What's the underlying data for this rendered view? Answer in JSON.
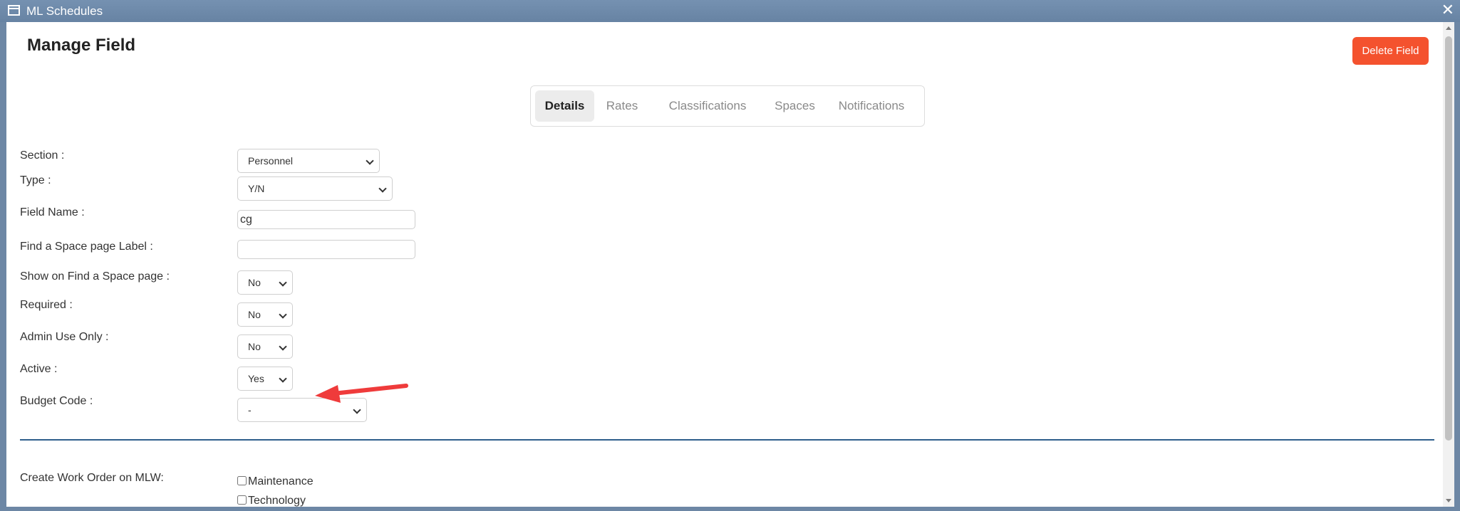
{
  "window": {
    "title": "ML Schedules",
    "icon": "window-icon",
    "close_symbol": "✕"
  },
  "header": {
    "title": "Manage Field",
    "delete_button": "Delete Field",
    "delete_color": "#f4522e"
  },
  "tabs": {
    "items": [
      "Details",
      "Rates",
      "Classifications",
      "Spaces",
      "Notifications"
    ],
    "active": "Details"
  },
  "form": {
    "section": {
      "label": "Section :",
      "value": "Personnel"
    },
    "type": {
      "label": "Type :",
      "value": "Y/N"
    },
    "field_name": {
      "label": "Field Name :",
      "value": "cg"
    },
    "space_label": {
      "label": "Find a Space page Label :",
      "value": ""
    },
    "show_on_find": {
      "label": "Show on Find a Space page :",
      "value": "No"
    },
    "required": {
      "label": "Required :",
      "value": "No"
    },
    "admin_only": {
      "label": "Admin Use Only :",
      "value": "No"
    },
    "active": {
      "label": "Active :",
      "value": "Yes"
    },
    "budget_code": {
      "label": "Budget Code :",
      "value": "-"
    }
  },
  "work_order": {
    "label": "Create Work Order on MLW:",
    "options": [
      {
        "label": "Maintenance",
        "checked": false
      },
      {
        "label": "Technology",
        "checked": false
      }
    ]
  },
  "annotation": {
    "arrow_color": "#ef3b3b",
    "icon": "red-arrow-pointer"
  }
}
